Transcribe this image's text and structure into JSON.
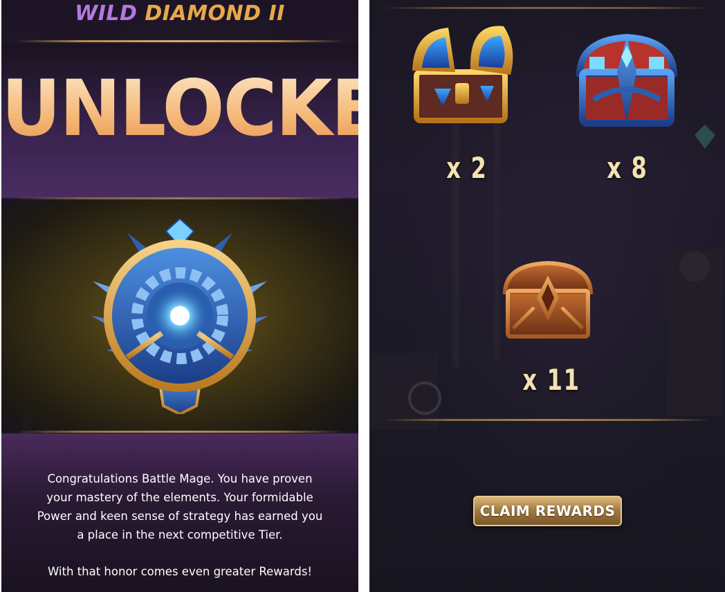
{
  "left": {
    "tier_word1": "WILD",
    "tier_word2": "DIAMOND II",
    "headline": "UNLOCKED",
    "message_lines": [
      "Congratulations Battle Mage. You have proven",
      "your mastery of the elements. Your formidable",
      "Power and keen sense of strategy has earned you",
      "a place in the next competitive Tier."
    ],
    "closing_line": "With that honor comes even greater Rewards!"
  },
  "right": {
    "rewards": [
      {
        "icon": "gold-chest-icon",
        "quantity": "x 2"
      },
      {
        "icon": "blue-chest-icon",
        "quantity": "x 8"
      },
      {
        "icon": "wooden-chest-icon",
        "quantity": "x 11"
      }
    ],
    "claim_label": "CLAIM REWARDS"
  },
  "colors": {
    "tier_word1": "#b478e0",
    "tier_word2": "#e7a84a",
    "headline": "#f5b877",
    "badge_blue": "#2a5fb0",
    "badge_gold": "#e0a23a",
    "button_gold": "#a57d42"
  },
  "icons": {
    "badge": "diamond-tier-badge-icon"
  }
}
